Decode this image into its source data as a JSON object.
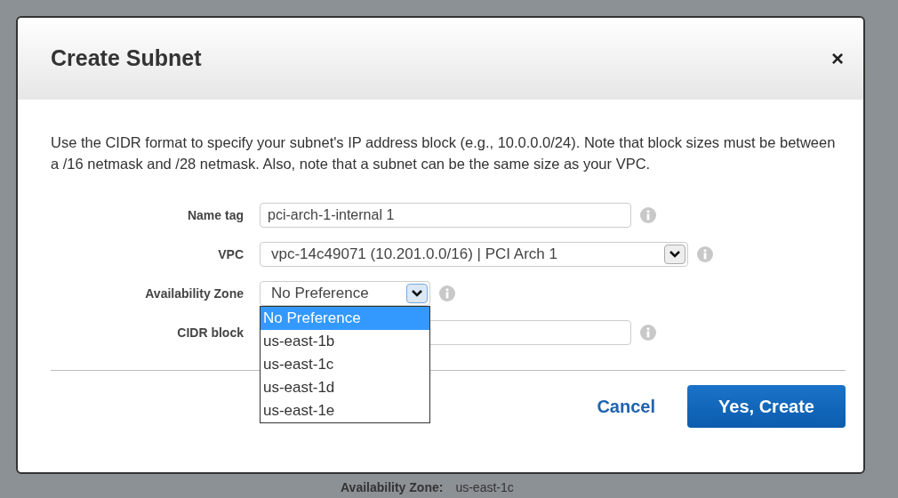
{
  "background": {
    "detail_label": "Availability Zone:",
    "detail_value": "us-east-1c"
  },
  "dialog": {
    "title": "Create Subnet",
    "close": "×",
    "description": "Use the CIDR format to specify your subnet's IP address block (e.g., 10.0.0.0/24). Note that block sizes must be between a /16 netmask and /28 netmask. Also, note that a subnet can be the same size as your VPC.",
    "fields": [
      {
        "kind": "text",
        "label": "Name tag",
        "value": "pci-arch-1-internal 1"
      },
      {
        "kind": "select",
        "label": "VPC",
        "value": "vpc-14c49071 (10.201.0.0/16) | PCI Arch 1"
      },
      {
        "kind": "select",
        "label": "Availability Zone",
        "value": "No Preference",
        "expanded": true,
        "options": [
          {
            "label": "No Preference",
            "selected": true
          },
          {
            "label": "us-east-1b",
            "selected": false
          },
          {
            "label": "us-east-1c",
            "selected": false
          },
          {
            "label": "us-east-1d",
            "selected": false
          },
          {
            "label": "us-east-1e",
            "selected": false
          }
        ]
      },
      {
        "kind": "text",
        "label": "CIDR block"
      }
    ],
    "buttons": [
      {
        "kind": "link",
        "label": "Cancel"
      },
      {
        "kind": "primary",
        "label": "Yes, Create"
      }
    ]
  }
}
